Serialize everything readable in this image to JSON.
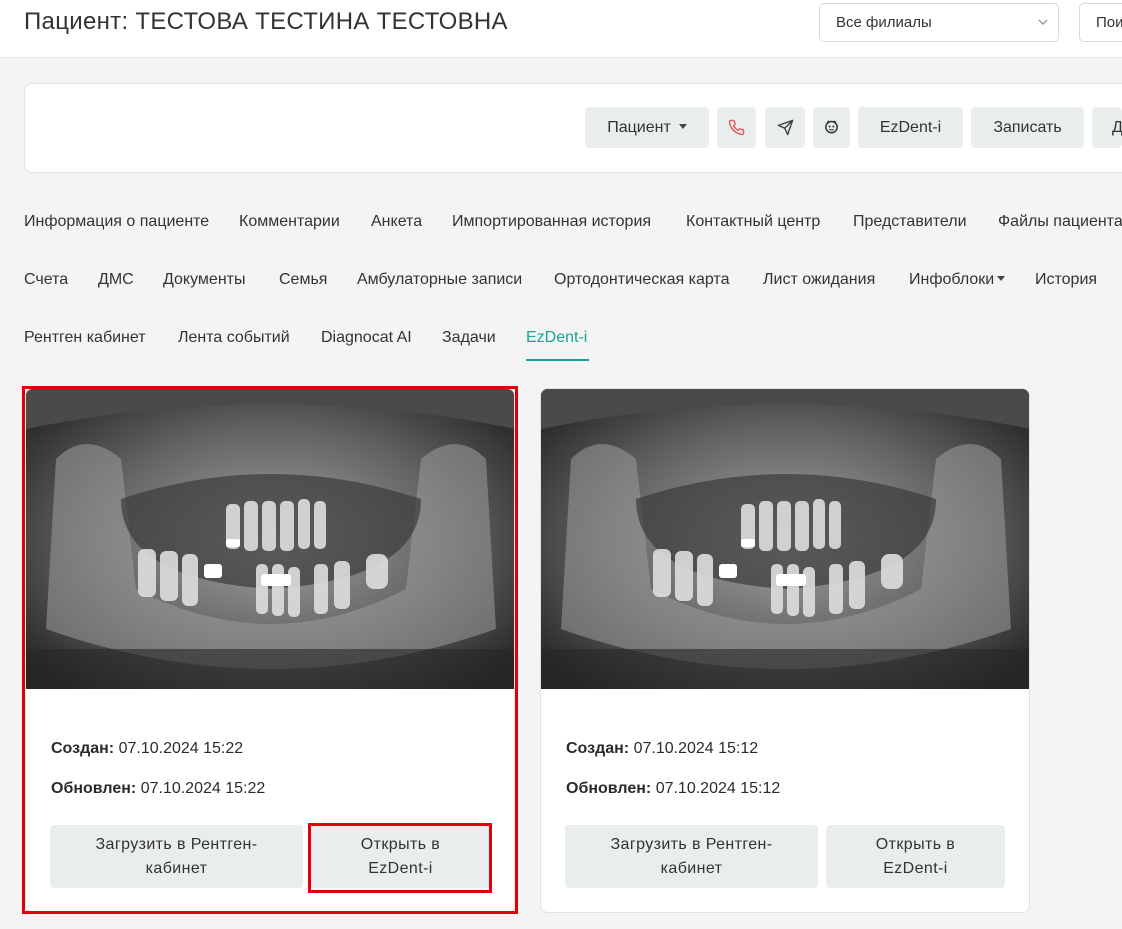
{
  "header": {
    "title": "Пациент: ТЕСТОВА ТЕСТИНА ТЕСТОВНА",
    "branch_select": "Все филиалы",
    "search_button": "Пои"
  },
  "actions": {
    "patient": "Пациент",
    "ezdent": "EzDent-i",
    "book": "Записать",
    "more": "Д",
    "icons": [
      "phone-icon",
      "send-icon",
      "smile-icon"
    ]
  },
  "tabs": {
    "row1": [
      "Информация о пациенте",
      "Комментарии",
      "Анкета",
      "Импортированная история",
      "Контактный центр",
      "Представители",
      "Файлы пациента"
    ],
    "row2": [
      "Счета",
      "ДМС",
      "Документы",
      "Семья",
      "Амбулаторные записи",
      "Ортодонтическая карта",
      "Лист ожидания",
      "Инфоблоки",
      "История"
    ],
    "row3": [
      "Рентген кабинет",
      "Лента событий",
      "Diagnocat AI",
      "Задачи",
      "EzDent-i"
    ],
    "active": "EzDent-i"
  },
  "cards": [
    {
      "created_label": "Создан:",
      "created": "07.10.2024 15:22",
      "updated_label": "Обновлен:",
      "updated": "07.10.2024 15:22",
      "upload_line1": "Загрузить в Рентген-",
      "upload_line2": "кабинет",
      "open_line1": "Открыть в",
      "open_line2": "EzDent-i"
    },
    {
      "created_label": "Создан:",
      "created": "07.10.2024 15:12",
      "updated_label": "Обновлен:",
      "updated": "07.10.2024 15:12",
      "upload_line1": "Загрузить в Рентген-",
      "upload_line2": "кабинет",
      "open_line1": "Открыть в",
      "open_line2": "EzDent-i"
    }
  ],
  "colors": {
    "accent": "#1aa394",
    "highlight": "#e0000a",
    "button_bg": "#e9eded",
    "phone_icon": "#e05a5a"
  }
}
